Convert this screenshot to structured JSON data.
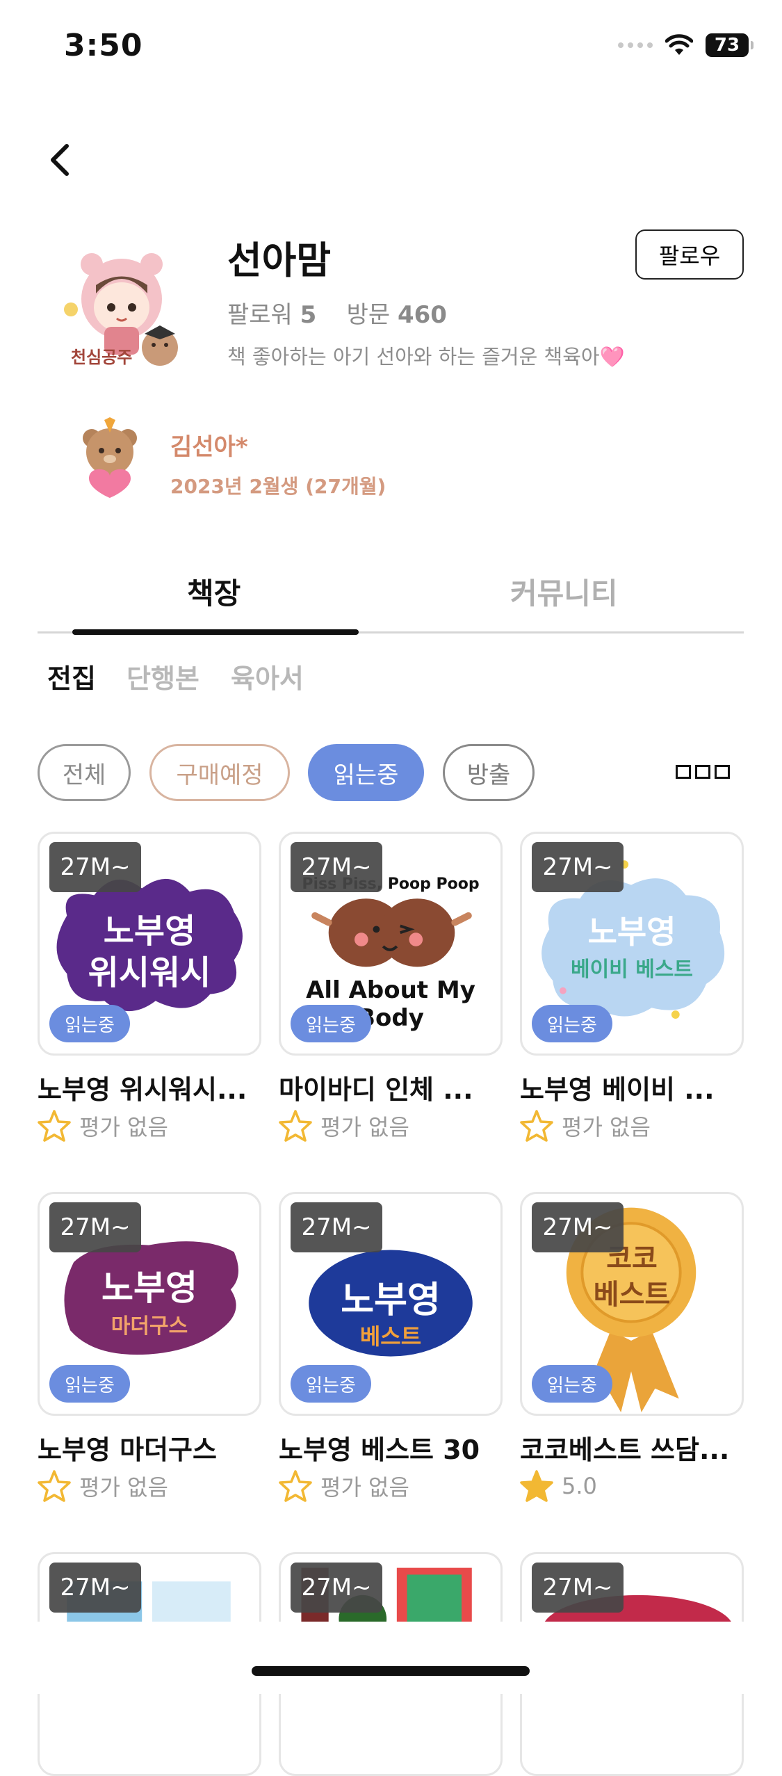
{
  "status_bar": {
    "time": "3:50",
    "battery": "73"
  },
  "profile": {
    "name": "선아맘",
    "follow_label": "팔로우",
    "followers_label": "팔로워",
    "followers": "5",
    "visits_label": "방문",
    "visits": "460",
    "bio": "책 좋아하는 아기 선아와 하는 즐거운 책육아🩷"
  },
  "child": {
    "name": "김선아*",
    "birth": "2023년 2월생 (27개월)"
  },
  "tabs": [
    "책장",
    "커뮤니티"
  ],
  "subtabs": [
    "전집",
    "단행본",
    "육아서"
  ],
  "filters": [
    "전체",
    "구매예정",
    "읽는중",
    "방출"
  ],
  "books": [
    {
      "age": "27M~",
      "status": "읽는중",
      "title": "노부영 위시워시...",
      "rating": "평가 없음",
      "cover_line1": "노부영",
      "cover_line2": "위시워시"
    },
    {
      "age": "27M~",
      "status": "읽는중",
      "title": "마이바디 인체 ...",
      "rating": "평가 없음",
      "cover_line1": "Piss Piss, Poop Poop",
      "cover_line2": "All About My Body"
    },
    {
      "age": "27M~",
      "status": "읽는중",
      "title": "노부영 베이비 ...",
      "rating": "평가 없음",
      "cover_line1": "노부영",
      "cover_line2": "베이비 베스트"
    },
    {
      "age": "27M~",
      "status": "읽는중",
      "title": "노부영 마더구스",
      "rating": "평가 없음",
      "cover_line1": "노부영",
      "cover_line2": "마더구스"
    },
    {
      "age": "27M~",
      "status": "읽는중",
      "title": "노부영 베스트 30",
      "rating": "평가 없음",
      "cover_line1": "노부영",
      "cover_line2": "베스트"
    },
    {
      "age": "27M~",
      "status": "읽는중",
      "title": "코코베스트 쓰담...",
      "rating": "5.0",
      "cover_line1": "코코",
      "cover_line2": "베스트"
    }
  ],
  "partial_cards": [
    {
      "age": "27M~"
    },
    {
      "age": "27M~"
    },
    {
      "age": "27M~"
    }
  ]
}
